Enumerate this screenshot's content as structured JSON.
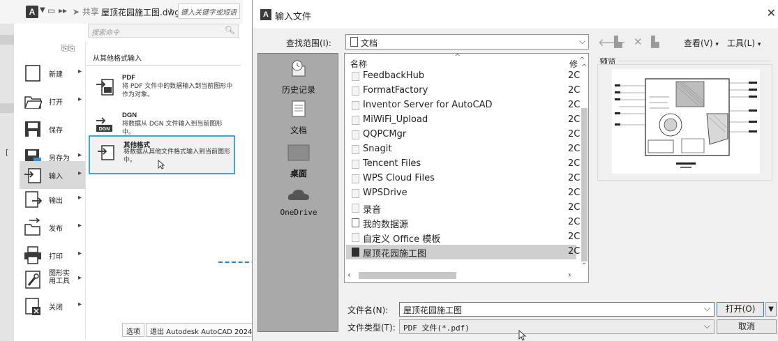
{
  "app_menu": {
    "logo": "A",
    "share_label": "共享",
    "document_title": "屋顶花园施工图.dwg",
    "keyword_placeholder": "键入关键字或短语",
    "search_placeholder": "搜索命令",
    "items": [
      {
        "label": "新建",
        "icon": "new-doc-icon"
      },
      {
        "label": "打开",
        "icon": "folder-open-icon"
      },
      {
        "label": "保存",
        "icon": "save-disk-icon"
      },
      {
        "label": "另存为",
        "icon": "save-as-icon"
      },
      {
        "label": "输入",
        "icon": "import-icon"
      },
      {
        "label": "输出",
        "icon": "export-icon"
      },
      {
        "label": "发布",
        "icon": "publish-icon"
      },
      {
        "label": "打印",
        "icon": "printer-icon"
      },
      {
        "label": "图形实用工具",
        "icon": "drawing-utilities-icon"
      },
      {
        "label": "关闭",
        "icon": "close-doc-icon"
      }
    ],
    "submenu": {
      "heading": "从其他格式输入",
      "entries": [
        {
          "title": "PDF",
          "desc": "将 PDF 文件中的数据输入到当前图形中作为对象。"
        },
        {
          "title": "DGN",
          "desc": "将数据从 DGN 文件输入到当前图形中。"
        },
        {
          "title": "其他格式",
          "desc": "将数据从其他文件格式输入到当前图形中。"
        }
      ]
    },
    "options_button": "选项",
    "exit_button": "退出 Autodesk AutoCAD 2024"
  },
  "dialog": {
    "title": "输入文件",
    "look_in_label": "查找范围(I):",
    "look_in_value": "文档",
    "view_menu": "查看(V)",
    "tools_menu": "工具(L)",
    "places": [
      "历史记录",
      "文档",
      "桌面",
      "OneDrive"
    ],
    "columns": {
      "name": "名称",
      "modified": "修"
    },
    "files": [
      {
        "name": "FeedbackHub",
        "mod": "2C",
        "type": "folder"
      },
      {
        "name": "FormatFactory",
        "mod": "2C",
        "type": "folder"
      },
      {
        "name": "Inventor Server for AutoCAD",
        "mod": "2C",
        "type": "folder"
      },
      {
        "name": "MiWiFi_Upload",
        "mod": "2C",
        "type": "folder"
      },
      {
        "name": "QQPCMgr",
        "mod": "2C",
        "type": "folder"
      },
      {
        "name": "Snagit",
        "mod": "2C",
        "type": "folder"
      },
      {
        "name": "Tencent Files",
        "mod": "2C",
        "type": "folder"
      },
      {
        "name": "WPS Cloud Files",
        "mod": "2C",
        "type": "folder"
      },
      {
        "name": "WPSDrive",
        "mod": "2C",
        "type": "folder"
      },
      {
        "name": "录音",
        "mod": "2C",
        "type": "folder"
      },
      {
        "name": "我的数据源",
        "mod": "2C",
        "type": "db"
      },
      {
        "name": "自定义 Office 模板",
        "mod": "2C",
        "type": "folder"
      },
      {
        "name": "屋顶花园施工图",
        "mod": "2C",
        "type": "dwg"
      }
    ],
    "preview_label": "预览",
    "file_name_label": "文件名(N):",
    "file_name_value": "屋顶花园施工图",
    "file_type_label": "文件类型(T):",
    "file_type_value": "PDF 文件(*.pdf)",
    "open_button": "打开(O)",
    "cancel_button": "取消"
  },
  "colors": {
    "highlight": "#3aa6dc",
    "connector": "#1e88d6",
    "places_bg": "#a9a9a9"
  }
}
